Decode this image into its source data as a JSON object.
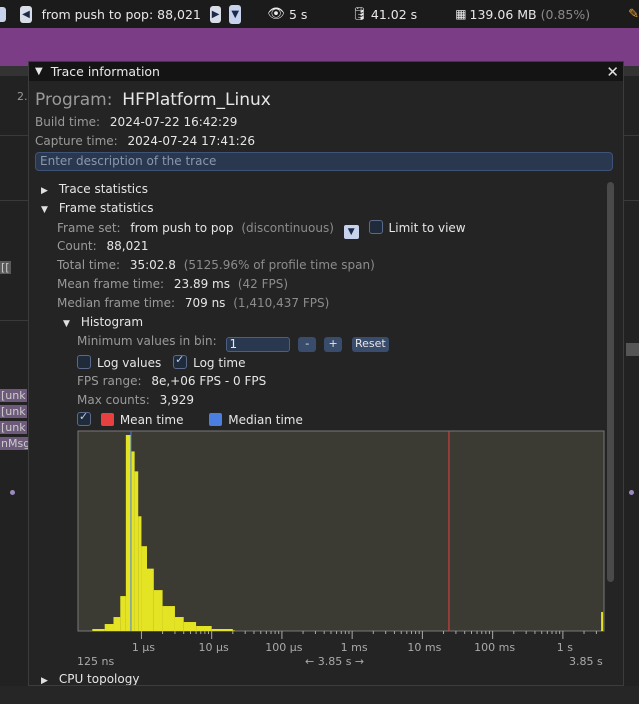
{
  "toolbar": {
    "frame_label": "from push to pop: 88,021",
    "view_time": "5 s",
    "trace_time": "41.02 s",
    "memory": "139.06 MB",
    "memory_pct": "(0.85%)",
    "icons": [
      "hamburger-icon",
      "prev-frame-icon",
      "next-frame-icon",
      "dropdown-icon",
      "eye-icon",
      "database-icon",
      "memory-icon",
      "pencil-icon"
    ]
  },
  "timeline_bg": {
    "labels": [
      "[[",
      "[unk",
      "[unk",
      "[unk",
      "nMsg"
    ],
    "tick_top": "2."
  },
  "window": {
    "title": "Trace information",
    "program_label": "Program:",
    "program_name": "HFPlatform_Linux",
    "build_time_label": "Build time:",
    "build_time": "2024-07-22 16:42:29",
    "capture_time_label": "Capture time:",
    "capture_time": "2024-07-24 17:41:26",
    "description_placeholder": "Enter description of the trace",
    "sections": {
      "trace_statistics": "Trace statistics",
      "frame_statistics": "Frame statistics",
      "histogram": "Histogram",
      "cpu_topology": "CPU topology"
    },
    "frame_set_label": "Frame set:",
    "frame_set_value": "from push to pop",
    "frame_set_kind": "(discontinuous)",
    "limit_to_view": "Limit to view",
    "count_label": "Count:",
    "count": "88,021",
    "total_time_label": "Total time:",
    "total_time": "35:02.8",
    "total_time_pct": "(5125.96% of profile time span)",
    "mean_label": "Mean frame time:",
    "mean": "23.89 ms",
    "mean_fps": "(42 FPS)",
    "median_label": "Median frame time:",
    "median": "709 ns",
    "median_fps": "(1,410,437 FPS)",
    "min_bin_label": "Minimum values in bin:",
    "min_bin_value": "1",
    "minus": "-",
    "plus": "+",
    "reset": "Reset",
    "log_values": "Log values",
    "log_time": "Log time",
    "fps_range_label": "FPS range:",
    "fps_range": "8e,+06 FPS - 0 FPS",
    "max_counts_label": "Max counts:",
    "max_counts": "3,929",
    "mean_time_legend": "Mean time",
    "median_time_legend": "Median time",
    "mean_color": "#e84040",
    "median_color": "#4a7ee0",
    "hist_color": "#e4e424"
  },
  "chart_data": {
    "type": "bar",
    "x_scale": "log",
    "x_range_ns": [
      125,
      3850000000
    ],
    "tick_labels": [
      "1 µs",
      "10 µs",
      "100 µs",
      "1 ms",
      "10 ms",
      "100 ms",
      "1 s"
    ],
    "range_start": "125 ns",
    "range_end": "3.85 s",
    "range_span": "← 3.85 s →",
    "mean_ns": 23890000,
    "median_ns": 709,
    "max_count": 3929,
    "bins": [
      {
        "t_ns": 200,
        "count": 40
      },
      {
        "t_ns": 300,
        "count": 140
      },
      {
        "t_ns": 400,
        "count": 280
      },
      {
        "t_ns": 500,
        "count": 700
      },
      {
        "t_ns": 600,
        "count": 3929
      },
      {
        "t_ns": 700,
        "count": 3600
      },
      {
        "t_ns": 800,
        "count": 3200
      },
      {
        "t_ns": 900,
        "count": 2300
      },
      {
        "t_ns": 1000,
        "count": 1700
      },
      {
        "t_ns": 1200,
        "count": 1250
      },
      {
        "t_ns": 1500,
        "count": 820
      },
      {
        "t_ns": 2000,
        "count": 500
      },
      {
        "t_ns": 3000,
        "count": 280
      },
      {
        "t_ns": 4000,
        "count": 180
      },
      {
        "t_ns": 6000,
        "count": 100
      },
      {
        "t_ns": 10000,
        "count": 40
      },
      {
        "t_ns": 20000,
        "count": 12
      },
      {
        "t_ns": 3500000000,
        "count": 380
      }
    ]
  }
}
